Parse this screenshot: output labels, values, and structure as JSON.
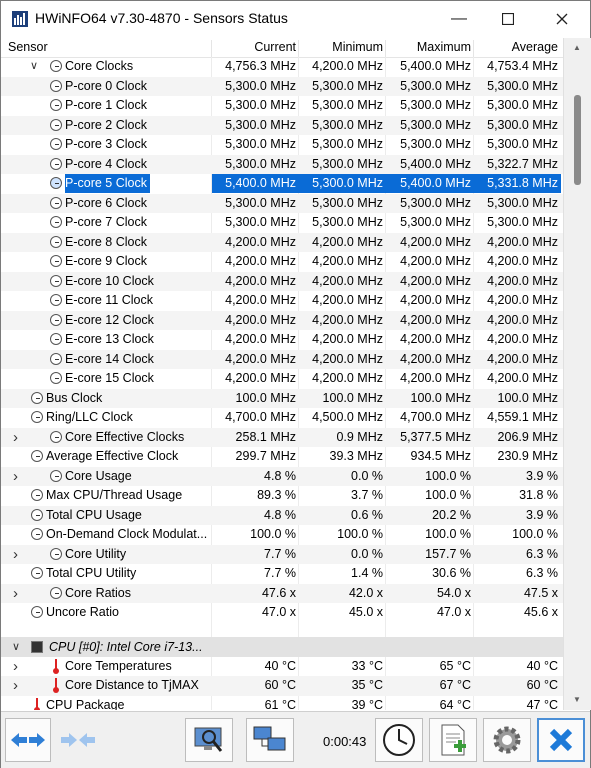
{
  "window": {
    "title": "HWiNFO64 v7.30-4870 - Sensors Status"
  },
  "header": {
    "sensor": "Sensor",
    "current": "Current",
    "minimum": "Minimum",
    "maximum": "Maximum",
    "average": "Average"
  },
  "rows": [
    {
      "indent": 1,
      "chevron": "v",
      "icon": "clock",
      "name": "Core Clocks",
      "cur": "4,756.3 MHz",
      "min": "4,200.0 MHz",
      "max": "5,400.0 MHz",
      "avg": "4,753.4 MHz"
    },
    {
      "indent": 2,
      "chevron": "",
      "icon": "clock",
      "name": "P-core 0 Clock",
      "cur": "5,300.0 MHz",
      "min": "5,300.0 MHz",
      "max": "5,300.0 MHz",
      "avg": "5,300.0 MHz"
    },
    {
      "indent": 2,
      "chevron": "",
      "icon": "clock",
      "name": "P-core 1 Clock",
      "cur": "5,300.0 MHz",
      "min": "5,300.0 MHz",
      "max": "5,300.0 MHz",
      "avg": "5,300.0 MHz"
    },
    {
      "indent": 2,
      "chevron": "",
      "icon": "clock",
      "name": "P-core 2 Clock",
      "cur": "5,300.0 MHz",
      "min": "5,300.0 MHz",
      "max": "5,300.0 MHz",
      "avg": "5,300.0 MHz"
    },
    {
      "indent": 2,
      "chevron": "",
      "icon": "clock",
      "name": "P-core 3 Clock",
      "cur": "5,300.0 MHz",
      "min": "5,300.0 MHz",
      "max": "5,300.0 MHz",
      "avg": "5,300.0 MHz"
    },
    {
      "indent": 2,
      "chevron": "",
      "icon": "clock",
      "name": "P-core 4 Clock",
      "cur": "5,300.0 MHz",
      "min": "5,300.0 MHz",
      "max": "5,400.0 MHz",
      "avg": "5,322.7 MHz"
    },
    {
      "indent": 2,
      "chevron": "",
      "icon": "clock",
      "name": "P-core 5 Clock",
      "cur": "5,400.0 MHz",
      "min": "5,300.0 MHz",
      "max": "5,400.0 MHz",
      "avg": "5,331.8 MHz",
      "selected": true
    },
    {
      "indent": 2,
      "chevron": "",
      "icon": "clock",
      "name": "P-core 6 Clock",
      "cur": "5,300.0 MHz",
      "min": "5,300.0 MHz",
      "max": "5,300.0 MHz",
      "avg": "5,300.0 MHz"
    },
    {
      "indent": 2,
      "chevron": "",
      "icon": "clock",
      "name": "P-core 7 Clock",
      "cur": "5,300.0 MHz",
      "min": "5,300.0 MHz",
      "max": "5,300.0 MHz",
      "avg": "5,300.0 MHz"
    },
    {
      "indent": 2,
      "chevron": "",
      "icon": "clock",
      "name": "E-core 8 Clock",
      "cur": "4,200.0 MHz",
      "min": "4,200.0 MHz",
      "max": "4,200.0 MHz",
      "avg": "4,200.0 MHz"
    },
    {
      "indent": 2,
      "chevron": "",
      "icon": "clock",
      "name": "E-core 9 Clock",
      "cur": "4,200.0 MHz",
      "min": "4,200.0 MHz",
      "max": "4,200.0 MHz",
      "avg": "4,200.0 MHz"
    },
    {
      "indent": 2,
      "chevron": "",
      "icon": "clock",
      "name": "E-core 10 Clock",
      "cur": "4,200.0 MHz",
      "min": "4,200.0 MHz",
      "max": "4,200.0 MHz",
      "avg": "4,200.0 MHz"
    },
    {
      "indent": 2,
      "chevron": "",
      "icon": "clock",
      "name": "E-core 11 Clock",
      "cur": "4,200.0 MHz",
      "min": "4,200.0 MHz",
      "max": "4,200.0 MHz",
      "avg": "4,200.0 MHz"
    },
    {
      "indent": 2,
      "chevron": "",
      "icon": "clock",
      "name": "E-core 12 Clock",
      "cur": "4,200.0 MHz",
      "min": "4,200.0 MHz",
      "max": "4,200.0 MHz",
      "avg": "4,200.0 MHz"
    },
    {
      "indent": 2,
      "chevron": "",
      "icon": "clock",
      "name": "E-core 13 Clock",
      "cur": "4,200.0 MHz",
      "min": "4,200.0 MHz",
      "max": "4,200.0 MHz",
      "avg": "4,200.0 MHz"
    },
    {
      "indent": 2,
      "chevron": "",
      "icon": "clock",
      "name": "E-core 14 Clock",
      "cur": "4,200.0 MHz",
      "min": "4,200.0 MHz",
      "max": "4,200.0 MHz",
      "avg": "4,200.0 MHz"
    },
    {
      "indent": 2,
      "chevron": "",
      "icon": "clock",
      "name": "E-core 15 Clock",
      "cur": "4,200.0 MHz",
      "min": "4,200.0 MHz",
      "max": "4,200.0 MHz",
      "avg": "4,200.0 MHz"
    },
    {
      "indent": 0,
      "chevron": "",
      "icon": "clock",
      "name": "Bus Clock",
      "cur": "100.0 MHz",
      "min": "100.0 MHz",
      "max": "100.0 MHz",
      "avg": "100.0 MHz"
    },
    {
      "indent": 0,
      "chevron": "",
      "icon": "clock",
      "name": "Ring/LLC Clock",
      "cur": "4,700.0 MHz",
      "min": "4,500.0 MHz",
      "max": "4,700.0 MHz",
      "avg": "4,559.1 MHz"
    },
    {
      "indent": 1,
      "chevron": ">",
      "icon": "clock",
      "name": "Core Effective Clocks",
      "cur": "258.1 MHz",
      "min": "0.9 MHz",
      "max": "5,377.5 MHz",
      "avg": "206.9 MHz"
    },
    {
      "indent": 0,
      "chevron": "",
      "icon": "clock",
      "name": "Average Effective Clock",
      "cur": "299.7 MHz",
      "min": "39.3 MHz",
      "max": "934.5 MHz",
      "avg": "230.9 MHz"
    },
    {
      "indent": 1,
      "chevron": ">",
      "icon": "clock",
      "name": "Core Usage",
      "cur": "4.8 %",
      "min": "0.0 %",
      "max": "100.0 %",
      "avg": "3.9 %"
    },
    {
      "indent": 0,
      "chevron": "",
      "icon": "clock",
      "name": "Max CPU/Thread Usage",
      "cur": "89.3 %",
      "min": "3.7 %",
      "max": "100.0 %",
      "avg": "31.8 %"
    },
    {
      "indent": 0,
      "chevron": "",
      "icon": "clock",
      "name": "Total CPU Usage",
      "cur": "4.8 %",
      "min": "0.6 %",
      "max": "20.2 %",
      "avg": "3.9 %"
    },
    {
      "indent": 0,
      "chevron": "",
      "icon": "clock",
      "name": "On-Demand Clock Modulat...",
      "cur": "100.0 %",
      "min": "100.0 %",
      "max": "100.0 %",
      "avg": "100.0 %"
    },
    {
      "indent": 1,
      "chevron": ">",
      "icon": "clock",
      "name": "Core Utility",
      "cur": "7.7 %",
      "min": "0.0 %",
      "max": "157.7 %",
      "avg": "6.3 %"
    },
    {
      "indent": 0,
      "chevron": "",
      "icon": "clock",
      "name": "Total CPU Utility",
      "cur": "7.7 %",
      "min": "1.4 %",
      "max": "30.6 %",
      "avg": "6.3 %"
    },
    {
      "indent": 1,
      "chevron": ">",
      "icon": "clock",
      "name": "Core Ratios",
      "cur": "47.6 x",
      "min": "42.0 x",
      "max": "54.0 x",
      "avg": "47.5 x"
    },
    {
      "indent": 0,
      "chevron": "",
      "icon": "clock",
      "name": "Uncore Ratio",
      "cur": "47.0 x",
      "min": "45.0 x",
      "max": "47.0 x",
      "avg": "45.6 x"
    }
  ],
  "group": {
    "name": "CPU [#0]: Intel Core i7-13..."
  },
  "group_rows": [
    {
      "indent": 1,
      "chevron": ">",
      "icon": "therm",
      "name": "Core Temperatures",
      "cur": "40 °C",
      "min": "33 °C",
      "max": "65 °C",
      "avg": "40 °C"
    },
    {
      "indent": 1,
      "chevron": ">",
      "icon": "therm",
      "name": "Core Distance to TjMAX",
      "cur": "60 °C",
      "min": "35 °C",
      "max": "67 °C",
      "avg": "60 °C"
    },
    {
      "indent": 0,
      "chevron": "",
      "icon": "therm",
      "name": "CPU Package",
      "cur": "61 °C",
      "min": "39 °C",
      "max": "64 °C",
      "avg": "47 °C"
    }
  ],
  "toolbar": {
    "timer": "0:00:43"
  },
  "colors": {
    "selection": "#0a6bd6",
    "close_blue": "#1e7ad8"
  }
}
